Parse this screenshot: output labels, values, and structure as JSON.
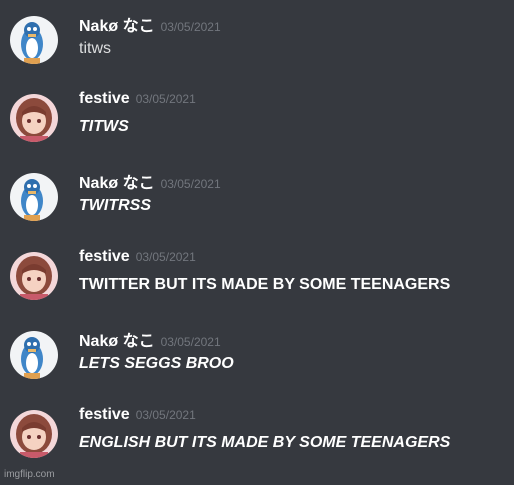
{
  "colors": {
    "background": "#36393f",
    "username": "#ffffff",
    "timestamp": "#72767d",
    "message_text": "#dcddde"
  },
  "messages": [
    {
      "author": "Nakø なこ",
      "timestamp": "03/05/2021",
      "text": "titws",
      "style": "normal",
      "avatar_icon": "penguin-avatar-icon"
    },
    {
      "author": "festive",
      "timestamp": "03/05/2021",
      "text": "TITWS",
      "style": "bold-italic",
      "avatar_icon": "anime-girl-avatar-icon"
    },
    {
      "author": "Nakø なこ",
      "timestamp": "03/05/2021",
      "text": "TWITRSS",
      "style": "bold-italic",
      "avatar_icon": "penguin-avatar-icon"
    },
    {
      "author": "festive",
      "timestamp": "03/05/2021",
      "text": "TWITTER BUT ITS MADE BY SOME TEENAGERS",
      "style": "bold",
      "avatar_icon": "anime-girl-avatar-icon"
    },
    {
      "author": "Nakø なこ",
      "timestamp": "03/05/2021",
      "text": "LETS SEGGS BROO",
      "style": "bold-italic",
      "avatar_icon": "penguin-avatar-icon"
    },
    {
      "author": "festive",
      "timestamp": "03/05/2021",
      "text": "ENGLISH BUT ITS MADE BY SOME TEENAGERS",
      "style": "bold-italic",
      "avatar_icon": "anime-girl-avatar-icon"
    }
  ],
  "watermark": "imgflip.com"
}
